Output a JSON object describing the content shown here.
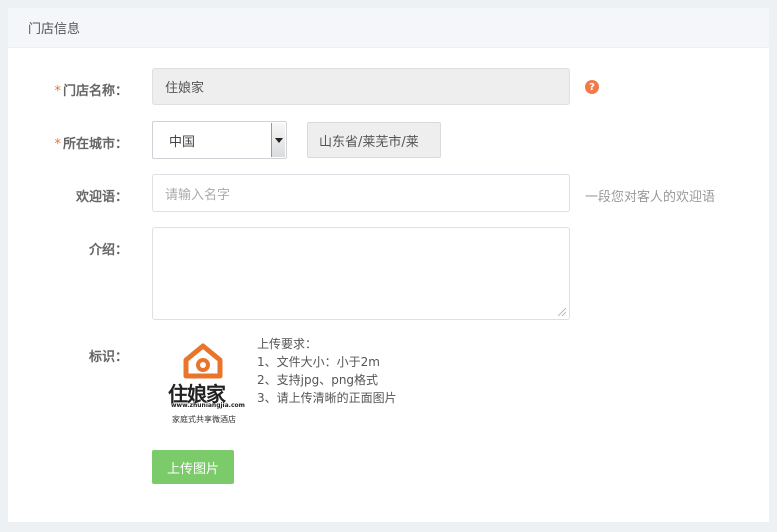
{
  "panel": {
    "title": "门店信息"
  },
  "form": {
    "store_name": {
      "label": "门店名称：",
      "value": "住娘家"
    },
    "city": {
      "label": "所在城市：",
      "country": "中国",
      "region": "山东省/莱芜市/莱"
    },
    "welcome": {
      "label": "欢迎语：",
      "placeholder": "请输入名字",
      "hint": "一段您对客人的欢迎语"
    },
    "intro": {
      "label": "介绍：",
      "value": ""
    },
    "logo": {
      "label": "标识：",
      "brand_text": "住娘家",
      "url_text": "www.zhuniangjia.com",
      "slogan": "家庭式共享微酒店",
      "requirements_title": "上传要求：",
      "requirements": [
        "1、文件大小：小于2m",
        "2、支持jpg、png格式",
        "3、请上传清晰的正面图片"
      ],
      "upload_label": "上传图片"
    },
    "required_mark": "*"
  },
  "colors": {
    "accent": "#e8752b",
    "upload_button": "#7ccb6a",
    "help_icon": "#f07a4a"
  },
  "icons": {
    "help": "question-circle-icon"
  }
}
